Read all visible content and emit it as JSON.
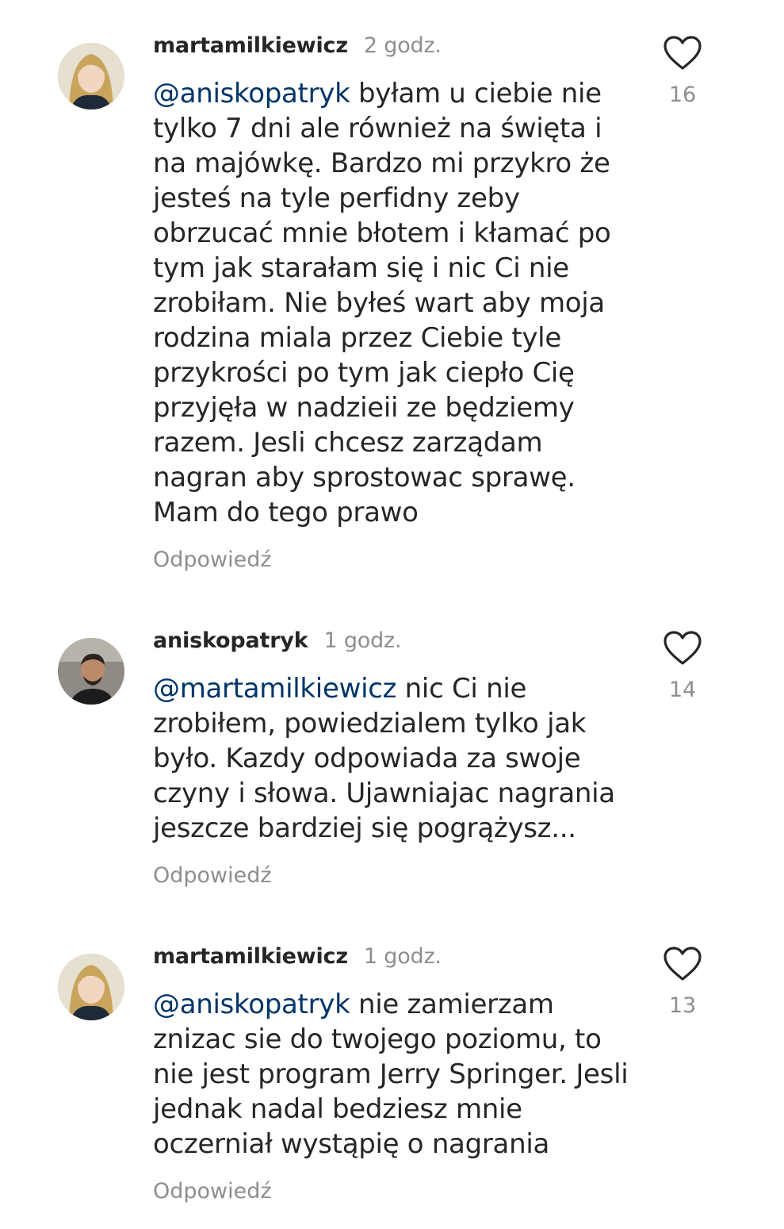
{
  "comments": [
    {
      "username": "martamilkiewicz",
      "time": "2 godz.",
      "mention": "@aniskopatryk",
      "text": " byłam u ciebie nie tylko 7 dni ale również na święta i na majówkę. Bardzo mi przykro że jesteś na tyle perfidny zeby obrzucać mnie błotem i kłamać po tym jak starałam się i nic Ci nie zrobiłam. Nie byłeś wart aby moja rodzina miala przez Ciebie tyle przykrości po tym jak ciepło Cię przyjęła w nadzieii ze będziemy razem. Jesli chcesz zarządam nagran aby sprostowac sprawę. Mam do tego prawo",
      "reply": "Odpowiedź",
      "likes": "16",
      "avatar_icon": "woman-avatar"
    },
    {
      "username": "aniskopatryk",
      "time": "1 godz.",
      "mention": "@martamilkiewicz",
      "text": " nic Ci nie zrobiłem, powiedzialem tylko jak było. Kazdy odpowiada za swoje czyny i słowa. Ujawniajac nagrania jeszcze bardziej się pogrążysz...",
      "reply": "Odpowiedź",
      "likes": "14",
      "avatar_icon": "man-avatar"
    },
    {
      "username": "martamilkiewicz",
      "time": "1 godz.",
      "mention": "@aniskopatryk",
      "text": " nie zamierzam znizac sie do twojego poziomu, to nie jest program Jerry Springer. Jesli jednak nadal bedziesz mnie oczerniał wystąpię o nagrania",
      "reply": "Odpowiedź",
      "likes": "13",
      "avatar_icon": "woman-avatar"
    }
  ],
  "colors": {
    "text": "#262626",
    "muted": "#8e8e8e",
    "mention": "#003569"
  }
}
